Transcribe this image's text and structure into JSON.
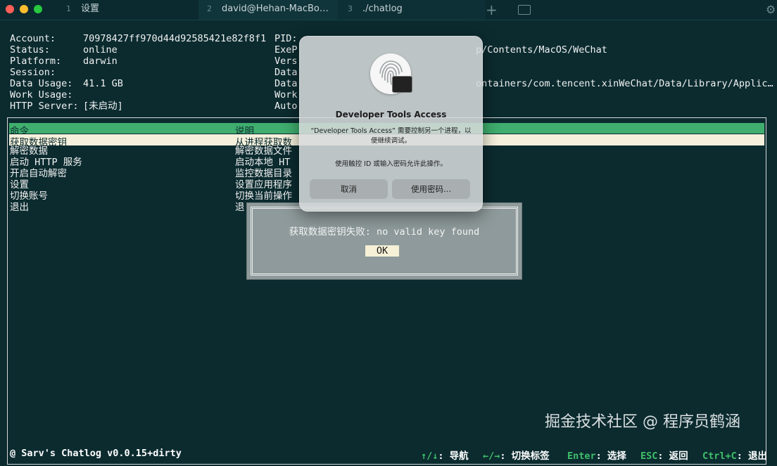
{
  "window": {
    "tabs": [
      {
        "num": "1",
        "label": "设置"
      },
      {
        "num": "2",
        "label": "david@Hehan-MacBo…"
      },
      {
        "num": "3",
        "label": "./chatlog"
      }
    ],
    "new_tab": "+"
  },
  "info": {
    "left": [
      {
        "key": "Account:",
        "value": "70978427ff970d44d92585421e82f8f1"
      },
      {
        "key": "Status:",
        "value": "online"
      },
      {
        "key": "Platform:",
        "value": "darwin"
      },
      {
        "key": "Session:",
        "value": ""
      },
      {
        "key": "Data Usage:",
        "value": "41.1 GB"
      },
      {
        "key": "Work Usage:",
        "value": ""
      },
      {
        "key": "HTTP Server:",
        "value": "[未启动]"
      }
    ],
    "right": [
      {
        "key": "PID:",
        "value": ""
      },
      {
        "key": "ExeP",
        "value": "p/Contents/MacOS/WeChat"
      },
      {
        "key": "Vers",
        "value": ""
      },
      {
        "key": "Data",
        "value": ""
      },
      {
        "key": "Data",
        "value": "ontainers/com.tencent.xinWeChat/Data/Library/Applic…"
      },
      {
        "key": "Work",
        "value": ""
      },
      {
        "key": "Auto",
        "value": ""
      }
    ]
  },
  "menu": {
    "header": {
      "cmd": "命令",
      "desc": "说明"
    },
    "items": [
      {
        "cmd": "获取数据密钥",
        "desc": "从进程获取数"
      },
      {
        "cmd": "解密数据",
        "desc": "解密数据文件"
      },
      {
        "cmd": "启动 HTTP 服务",
        "desc": "启动本地 HT"
      },
      {
        "cmd": "开启自动解密",
        "desc": "监控数据目录"
      },
      {
        "cmd": "设置",
        "desc": "设置应用程序"
      },
      {
        "cmd": "切换账号",
        "desc": "切换当前操作"
      },
      {
        "cmd": "退出",
        "desc": "退"
      }
    ]
  },
  "error_dialog": {
    "message": "获取数据密钥失败: no valid key found",
    "ok": "OK"
  },
  "auth_sheet": {
    "title": "Developer Tools Access",
    "text": "“Developer Tools Access” 需要控制另一个进程，以便继续调试。",
    "text2": "使用触控 ID 或输入密码允许此操作。",
    "cancel": "取消",
    "use_password": "使用密码..."
  },
  "footer": {
    "app": "@ Sarv's Chatlog v0.0.15+dirty",
    "hints": [
      {
        "key": "↑/↓",
        "label": ": 导航"
      },
      {
        "key": "←/→",
        "label": ": 切换标签"
      },
      {
        "key": "Enter",
        "label": ": 选择"
      },
      {
        "key": "ESC",
        "label": ": 返回"
      },
      {
        "key": "Ctrl+C",
        "label": ": 退出"
      }
    ]
  },
  "watermark": "掘金技术社区 @ 程序员鹤涵",
  "colors": {
    "background": "#0b2b2f",
    "header_green": "#3fae6e",
    "selected_row": "#f4f0dc",
    "hint_key": "#3fbf6a"
  }
}
